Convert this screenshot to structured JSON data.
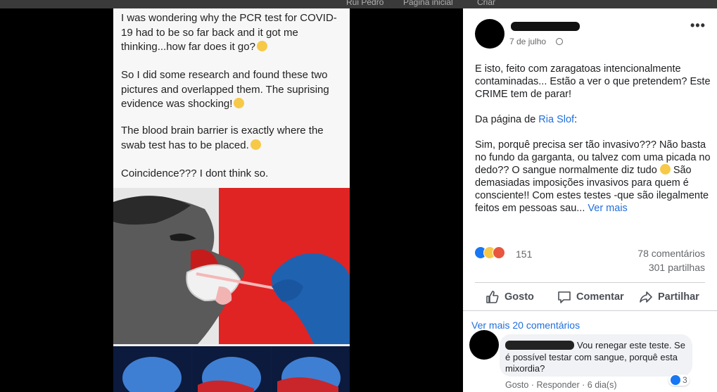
{
  "topbar": {
    "items": [
      "Rui Pedro",
      "Página inicial",
      "Criar"
    ]
  },
  "photo": {
    "paragraphs": [
      "I was wondering why the PCR test for COVID-19 had to be so far back and it got me thinking...how far does it go?",
      "So I  did some research and found these two pictures and overlapped them. The suprising evidence was shocking!",
      "The blood brain barrier is exactly where the swab test has to be placed.",
      "Coincidence??? I dont think so."
    ]
  },
  "post": {
    "date": "7 de julho",
    "menu_icon": "more-horizontal-icon",
    "body_1": "E isto, feito com zaragatoas intencionalmente contaminadas... Estão a ver o que pretendem? Este CRIME tem de parar!",
    "body_2_prefix": "Da página de ",
    "body_2_link": "Ria Slof",
    "body_2_suffix": ":",
    "body_3a": "Sim, porquê precisa ser tão invasivo??? Não basta no fundo da garganta, ou talvez com uma picada no dedo?? O sangue normalmente diz tudo ",
    "body_3b": " São demasiadas imposições invasivos para quem é consciente!! Com estes testes -que são ilegalmente feitos em pessoas sau...",
    "see_more": "Ver mais",
    "reaction_count": "151",
    "comments_count": "78 comentários",
    "shares_count": "301 partilhas",
    "actions": {
      "like": "Gosto",
      "comment": "Comentar",
      "share": "Partilhar"
    }
  },
  "comments": {
    "view_more": "Ver mais 20 comentários",
    "first": {
      "text": "Vou renegar este teste. Se é possível testar com sangue, porquê esta mixordia?",
      "like_count": "3",
      "action_like": "Gosto",
      "action_reply": "Responder",
      "age": "6 dia(s)",
      "separator": "·"
    }
  },
  "colors": {
    "link": "#216fdb",
    "like_blue": "#1877f2",
    "muted": "#65676b",
    "divider": "#ced0d4"
  }
}
